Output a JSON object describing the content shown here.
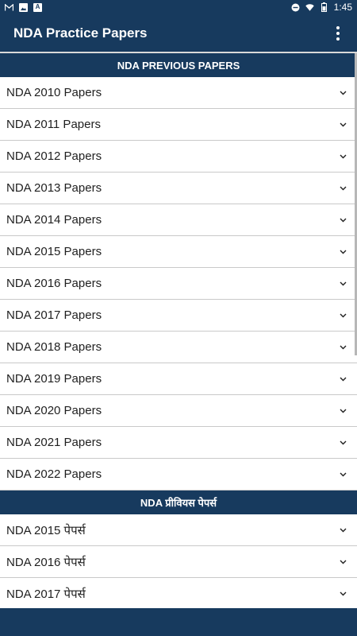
{
  "status_bar": {
    "left_icons": [
      "gmail-icon",
      "image-icon",
      "font-icon"
    ],
    "right_icons": [
      "do-not-disturb-icon",
      "wifi-icon",
      "battery-icon"
    ],
    "time": "1:45"
  },
  "app_bar": {
    "title": "NDA Practice Papers",
    "menu_icon": "more-vert-icon"
  },
  "sections": [
    {
      "header": "NDA PREVIOUS PAPERS",
      "items": [
        "NDA 2010 Papers",
        "NDA 2011 Papers",
        "NDA 2012 Papers",
        "NDA 2013 Papers",
        "NDA 2014 Papers",
        "NDA 2015 Papers",
        "NDA 2016 Papers",
        "NDA 2017 Papers",
        "NDA 2018 Papers",
        "NDA 2019 Papers",
        "NDA 2020 Papers",
        "NDA 2021 Papers",
        "NDA 2022 Papers"
      ]
    },
    {
      "header": "NDA प्रीवियस पेपर्स",
      "items": [
        "NDA 2015 पेपर्स",
        "NDA 2016 पेपर्स",
        "NDA 2017 पेपर्स"
      ]
    }
  ],
  "colors": {
    "primary": "#173a5e",
    "divider": "#c9c9c9",
    "text": "#1f1f1f"
  }
}
